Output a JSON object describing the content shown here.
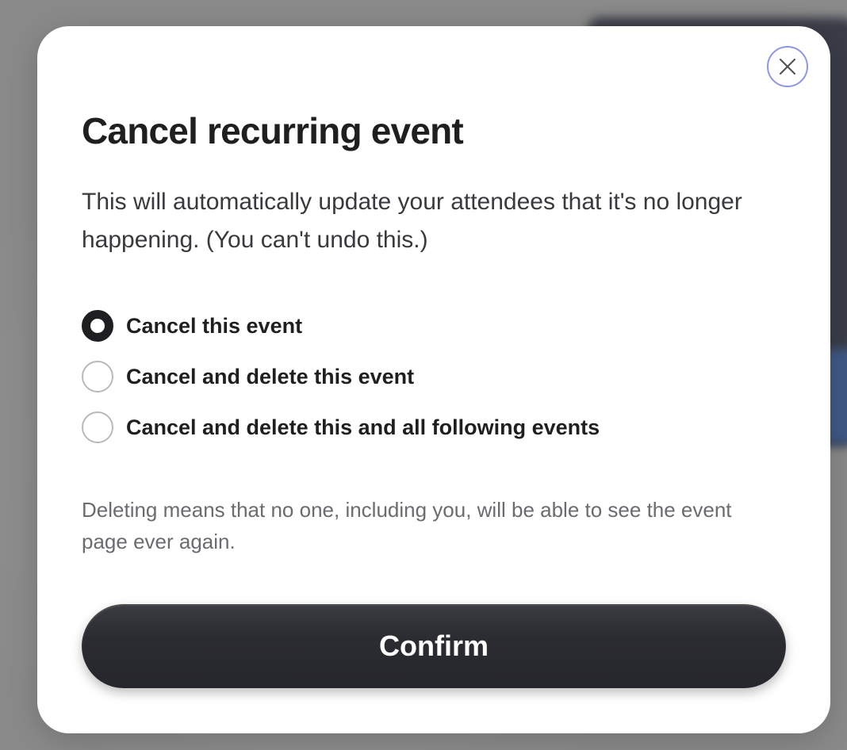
{
  "modal": {
    "title": "Cancel recurring event",
    "description": "This will automatically update your attendees that it's no longer happening. (You can't undo this.)",
    "options": [
      {
        "label": "Cancel this event",
        "selected": true
      },
      {
        "label": "Cancel and delete this event",
        "selected": false
      },
      {
        "label": "Cancel and delete this and all following events",
        "selected": false
      }
    ],
    "note": "Deleting means that no one, including you, will be able to see the event page ever again.",
    "confirm_label": "Confirm",
    "close_icon": "close-icon"
  },
  "colors": {
    "primary_dark": "#1f1f22",
    "button_bg": "#2b2c31",
    "close_ring": "#8f95e6",
    "muted_text": "#6b6b70",
    "radio_border": "#b9b9bd"
  }
}
